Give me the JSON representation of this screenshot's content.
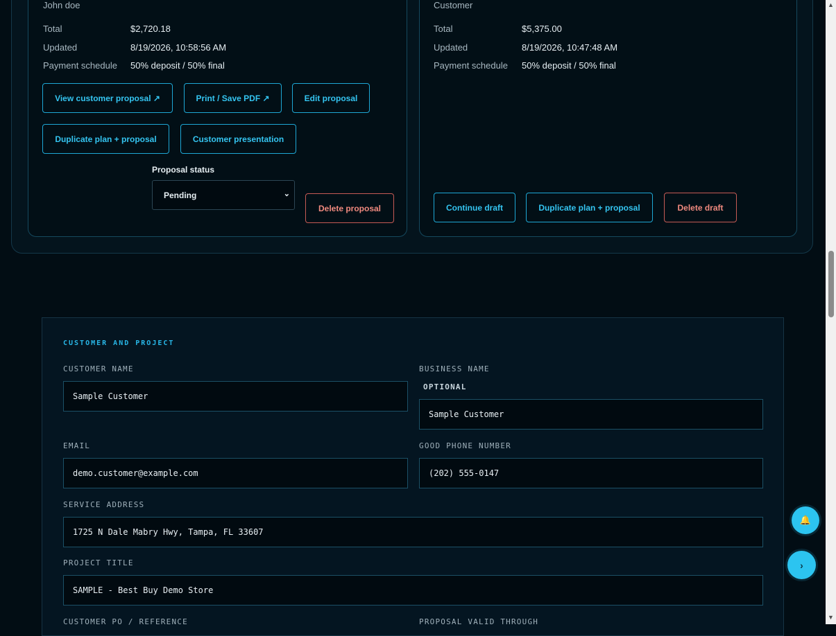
{
  "proposals": {
    "left": {
      "subtitle": "John doe",
      "meta": [
        {
          "label": "Total",
          "value": "$2,720.18"
        },
        {
          "label": "Updated",
          "value": "8/19/2026, 10:58:56 AM"
        },
        {
          "label": "Payment schedule",
          "value": "50% deposit / 50% final"
        }
      ],
      "buttons": {
        "view": "View customer proposal ↗",
        "print": "Print / Save PDF ↗",
        "edit": "Edit proposal",
        "duplicate": "Duplicate plan + proposal",
        "presentation": "Customer presentation",
        "delete": "Delete proposal"
      },
      "status_label": "Proposal status",
      "status_value": "Pending"
    },
    "right": {
      "subtitle": "Customer",
      "meta": [
        {
          "label": "Total",
          "value": "$5,375.00"
        },
        {
          "label": "Updated",
          "value": "8/19/2026, 10:47:48 AM"
        },
        {
          "label": "Payment schedule",
          "value": "50% deposit / 50% final"
        }
      ],
      "buttons": {
        "continue": "Continue draft",
        "duplicate": "Duplicate plan + proposal",
        "delete": "Delete draft"
      }
    }
  },
  "form": {
    "section_title": "CUSTOMER AND PROJECT",
    "customer_name": {
      "label": "CUSTOMER NAME",
      "value": "Sample Customer"
    },
    "business_name": {
      "label": "BUSINESS NAME",
      "optional": "OPTIONAL",
      "value": "Sample Customer"
    },
    "email": {
      "label": "EMAIL",
      "value": "demo.customer@example.com"
    },
    "phone": {
      "label": "GOOD PHONE NUMBER",
      "value": "(202) 555-0147"
    },
    "service_address": {
      "label": "SERVICE ADDRESS",
      "value": "1725 N Dale Mabry Hwy, Tampa, FL 33607"
    },
    "project_title": {
      "label": "PROJECT TITLE",
      "value": "SAMPLE - Best Buy Demo Store"
    },
    "customer_po": {
      "label": "CUSTOMER PO / REFERENCE"
    },
    "valid_through": {
      "label": "PROPOSAL VALID THROUGH"
    }
  },
  "floating": {
    "bell": "🔔",
    "next": "›"
  },
  "colors": {
    "background": "#020d14",
    "accent": "#34c4f0",
    "danger": "#f08a7f",
    "panel_border": "#15495e"
  },
  "icons": {
    "bell": "bell-icon",
    "next": "chevron-right-icon",
    "select": "chevron-down-icon"
  }
}
